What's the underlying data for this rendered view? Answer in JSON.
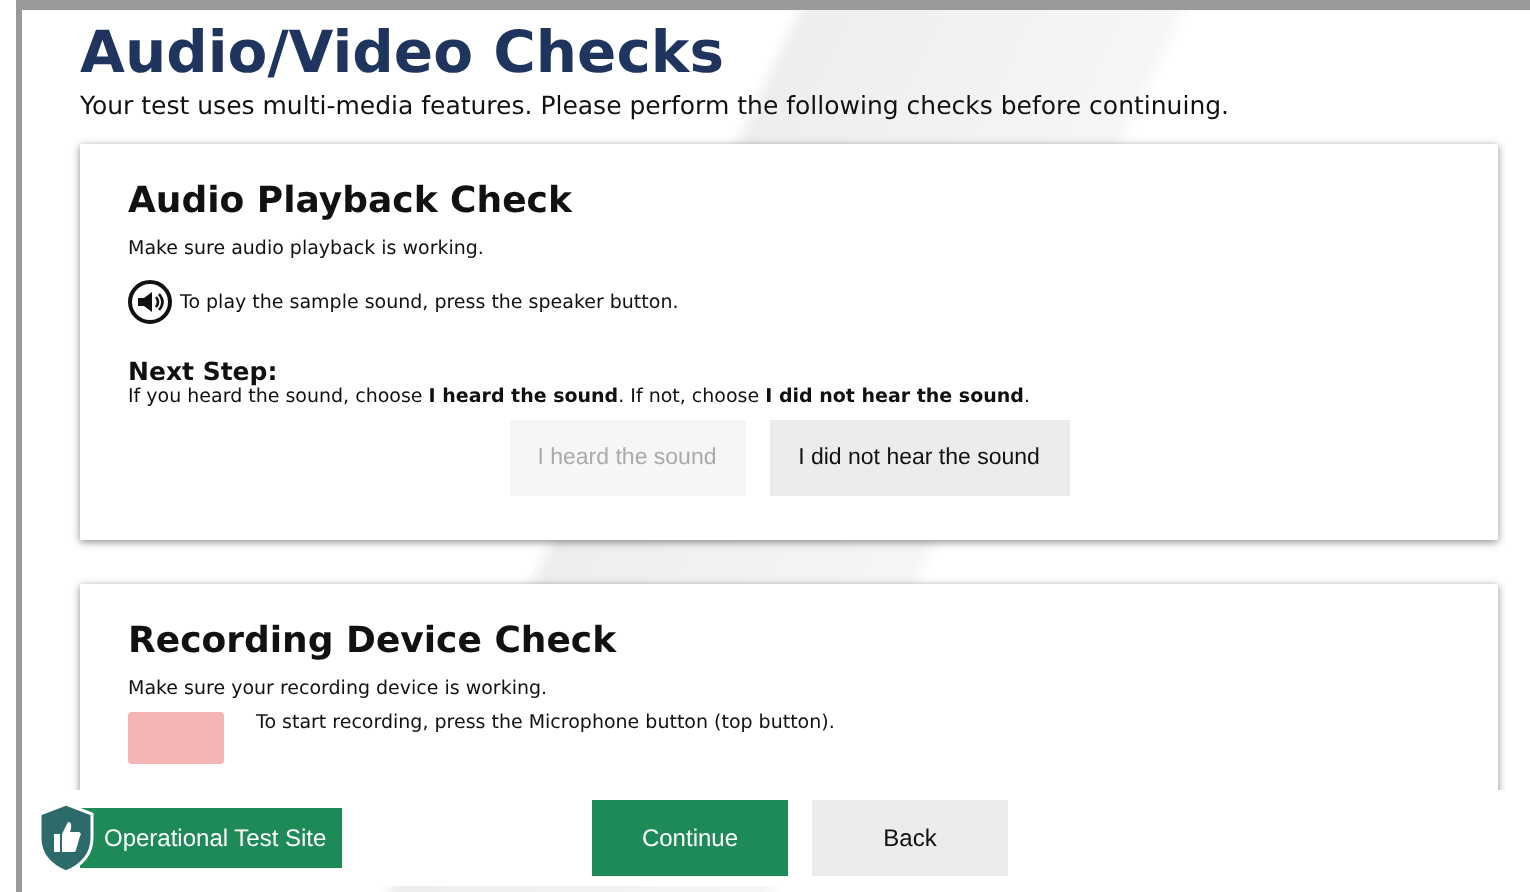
{
  "page": {
    "title": "Audio/Video Checks",
    "subtitle": "Your test uses multi-media features. Please perform the following checks before continuing."
  },
  "audio_check": {
    "title": "Audio Playback Check",
    "instruction": "Make sure audio playback is working.",
    "speaker_hint": "To play the sample sound, press the speaker button.",
    "next_step_label": "Next Step:",
    "next_step_text": "If you heard the sound, choose **I heard the sound**. If not, choose **I did not hear the sound**.",
    "buttons": [
      {
        "label": "I heard the sound",
        "disabled": true
      },
      {
        "label": "I did not hear the sound",
        "disabled": false
      }
    ]
  },
  "recording_check": {
    "title": "Recording Device Check",
    "instruction": "Make sure your recording device is working.",
    "microphone_hint": "To start recording, press the Microphone button (top button)."
  },
  "footer": {
    "site_label": "Operational Test Site",
    "buttons": [
      {
        "label": "Continue",
        "kind": "primary"
      },
      {
        "label": "Back",
        "kind": "secondary"
      }
    ]
  }
}
